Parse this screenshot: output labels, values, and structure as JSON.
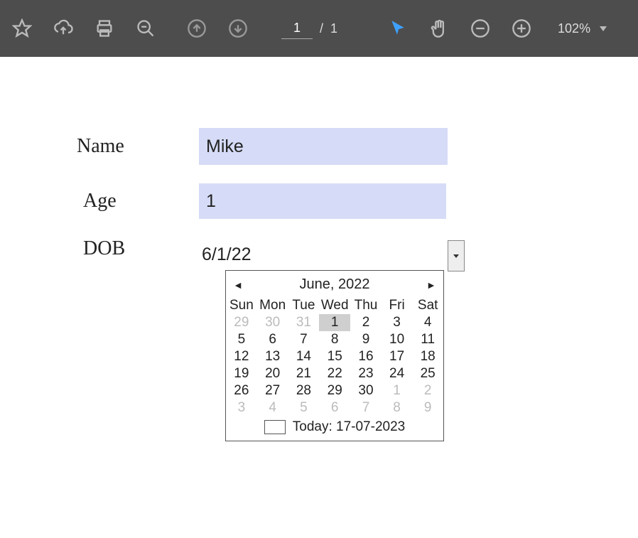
{
  "toolbar": {
    "page_current": "1",
    "page_sep": "/",
    "page_total": "1",
    "zoom": "102%"
  },
  "form": {
    "name_label": "Name",
    "name_value": "Mike",
    "age_label": "Age",
    "age_value": "1",
    "dob_label": "DOB",
    "dob_value": "6/1/22"
  },
  "calendar": {
    "month_label": "June, 2022",
    "days": [
      "Sun",
      "Mon",
      "Tue",
      "Wed",
      "Thu",
      "Fri",
      "Sat"
    ],
    "grid": [
      [
        {
          "n": "29",
          "t": "muted"
        },
        {
          "n": "30",
          "t": "muted"
        },
        {
          "n": "31",
          "t": "muted"
        },
        {
          "n": "1",
          "t": "sel"
        },
        {
          "n": "2",
          "t": ""
        },
        {
          "n": "3",
          "t": ""
        },
        {
          "n": "4",
          "t": ""
        }
      ],
      [
        {
          "n": "5",
          "t": ""
        },
        {
          "n": "6",
          "t": ""
        },
        {
          "n": "7",
          "t": ""
        },
        {
          "n": "8",
          "t": ""
        },
        {
          "n": "9",
          "t": ""
        },
        {
          "n": "10",
          "t": ""
        },
        {
          "n": "11",
          "t": ""
        }
      ],
      [
        {
          "n": "12",
          "t": ""
        },
        {
          "n": "13",
          "t": ""
        },
        {
          "n": "14",
          "t": ""
        },
        {
          "n": "15",
          "t": ""
        },
        {
          "n": "16",
          "t": ""
        },
        {
          "n": "17",
          "t": ""
        },
        {
          "n": "18",
          "t": ""
        }
      ],
      [
        {
          "n": "19",
          "t": ""
        },
        {
          "n": "20",
          "t": ""
        },
        {
          "n": "21",
          "t": ""
        },
        {
          "n": "22",
          "t": ""
        },
        {
          "n": "23",
          "t": ""
        },
        {
          "n": "24",
          "t": ""
        },
        {
          "n": "25",
          "t": ""
        }
      ],
      [
        {
          "n": "26",
          "t": ""
        },
        {
          "n": "27",
          "t": ""
        },
        {
          "n": "28",
          "t": ""
        },
        {
          "n": "29",
          "t": ""
        },
        {
          "n": "30",
          "t": ""
        },
        {
          "n": "1",
          "t": "muted"
        },
        {
          "n": "2",
          "t": "muted"
        }
      ],
      [
        {
          "n": "3",
          "t": "muted"
        },
        {
          "n": "4",
          "t": "muted"
        },
        {
          "n": "5",
          "t": "muted"
        },
        {
          "n": "6",
          "t": "muted"
        },
        {
          "n": "7",
          "t": "muted"
        },
        {
          "n": "8",
          "t": "muted"
        },
        {
          "n": "9",
          "t": "muted"
        }
      ]
    ],
    "today_label": "Today: 17-07-2023"
  }
}
